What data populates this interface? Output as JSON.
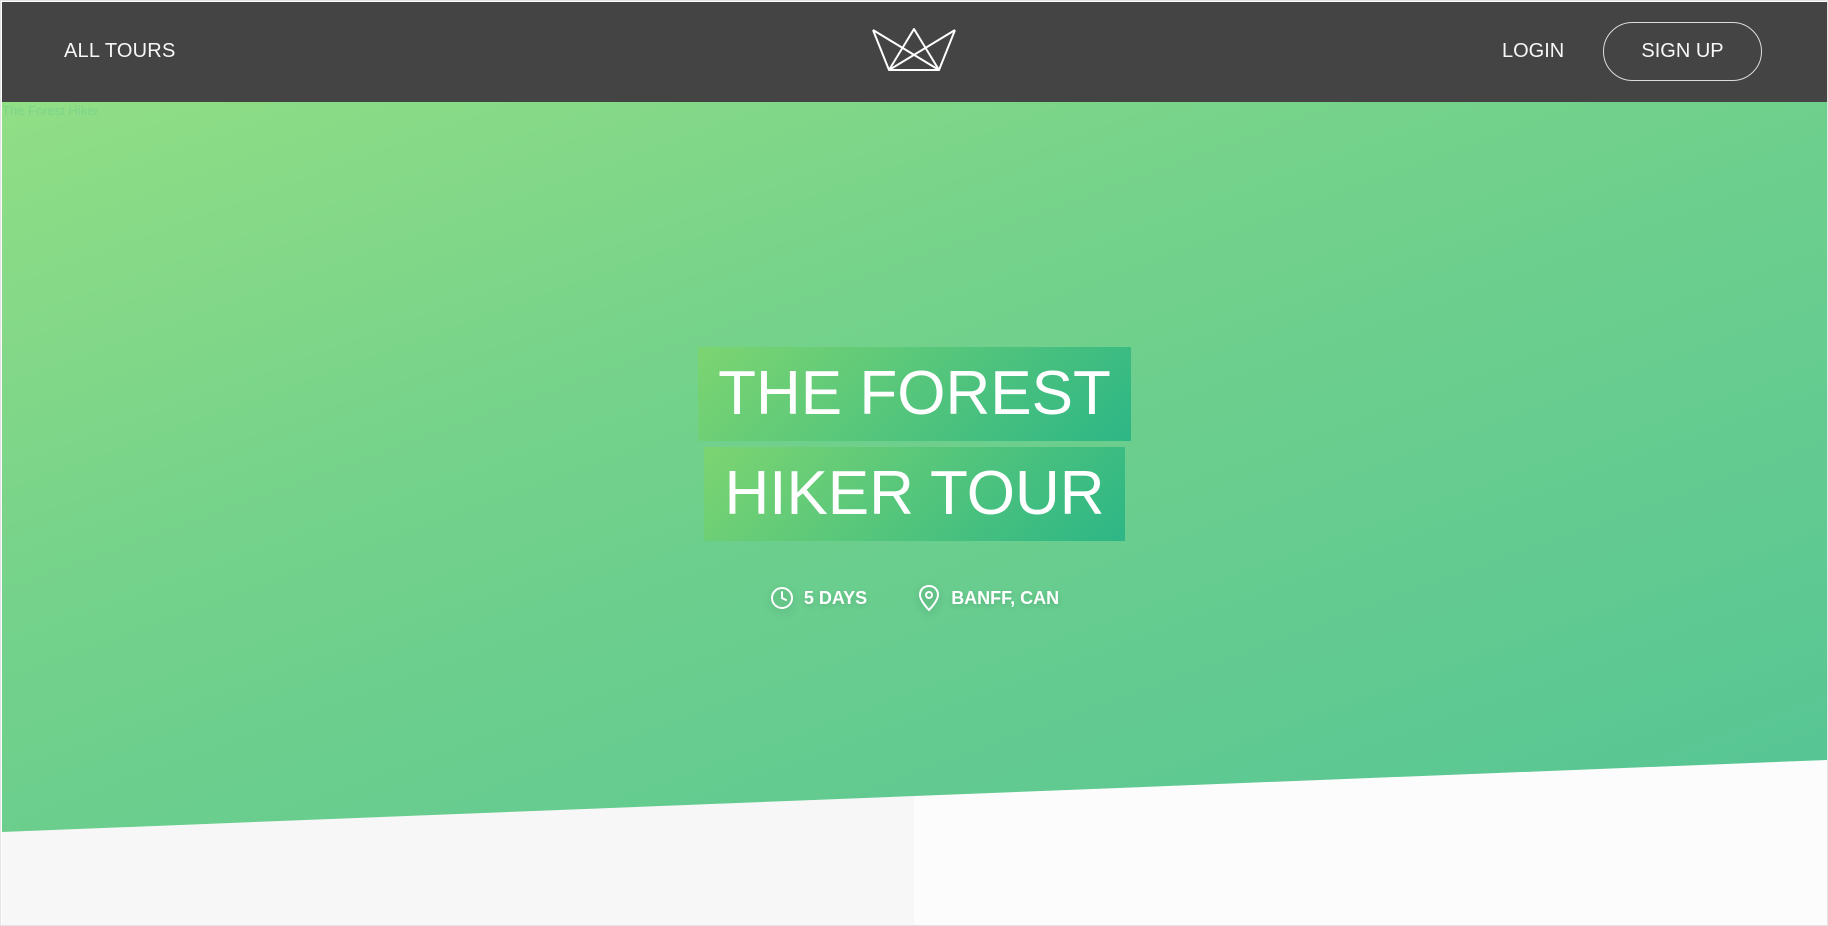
{
  "header": {
    "all_tours_label": "ALL TOURS",
    "login_label": "LOGIN",
    "signup_label": "SIGN UP"
  },
  "hero": {
    "image_alt": "The Forest Hiker",
    "title_line1": "THE FOREST",
    "title_line2": "HIKER TOUR",
    "duration": "5 DAYS",
    "location": "BANFF, CAN",
    "icons": [
      "clock-icon",
      "map-pin-icon"
    ]
  },
  "colors": {
    "header_bg": "#444444",
    "hero_gradient_start": "#91de85",
    "hero_gradient_end": "#55c595",
    "text_light": "#f7f7f7"
  }
}
